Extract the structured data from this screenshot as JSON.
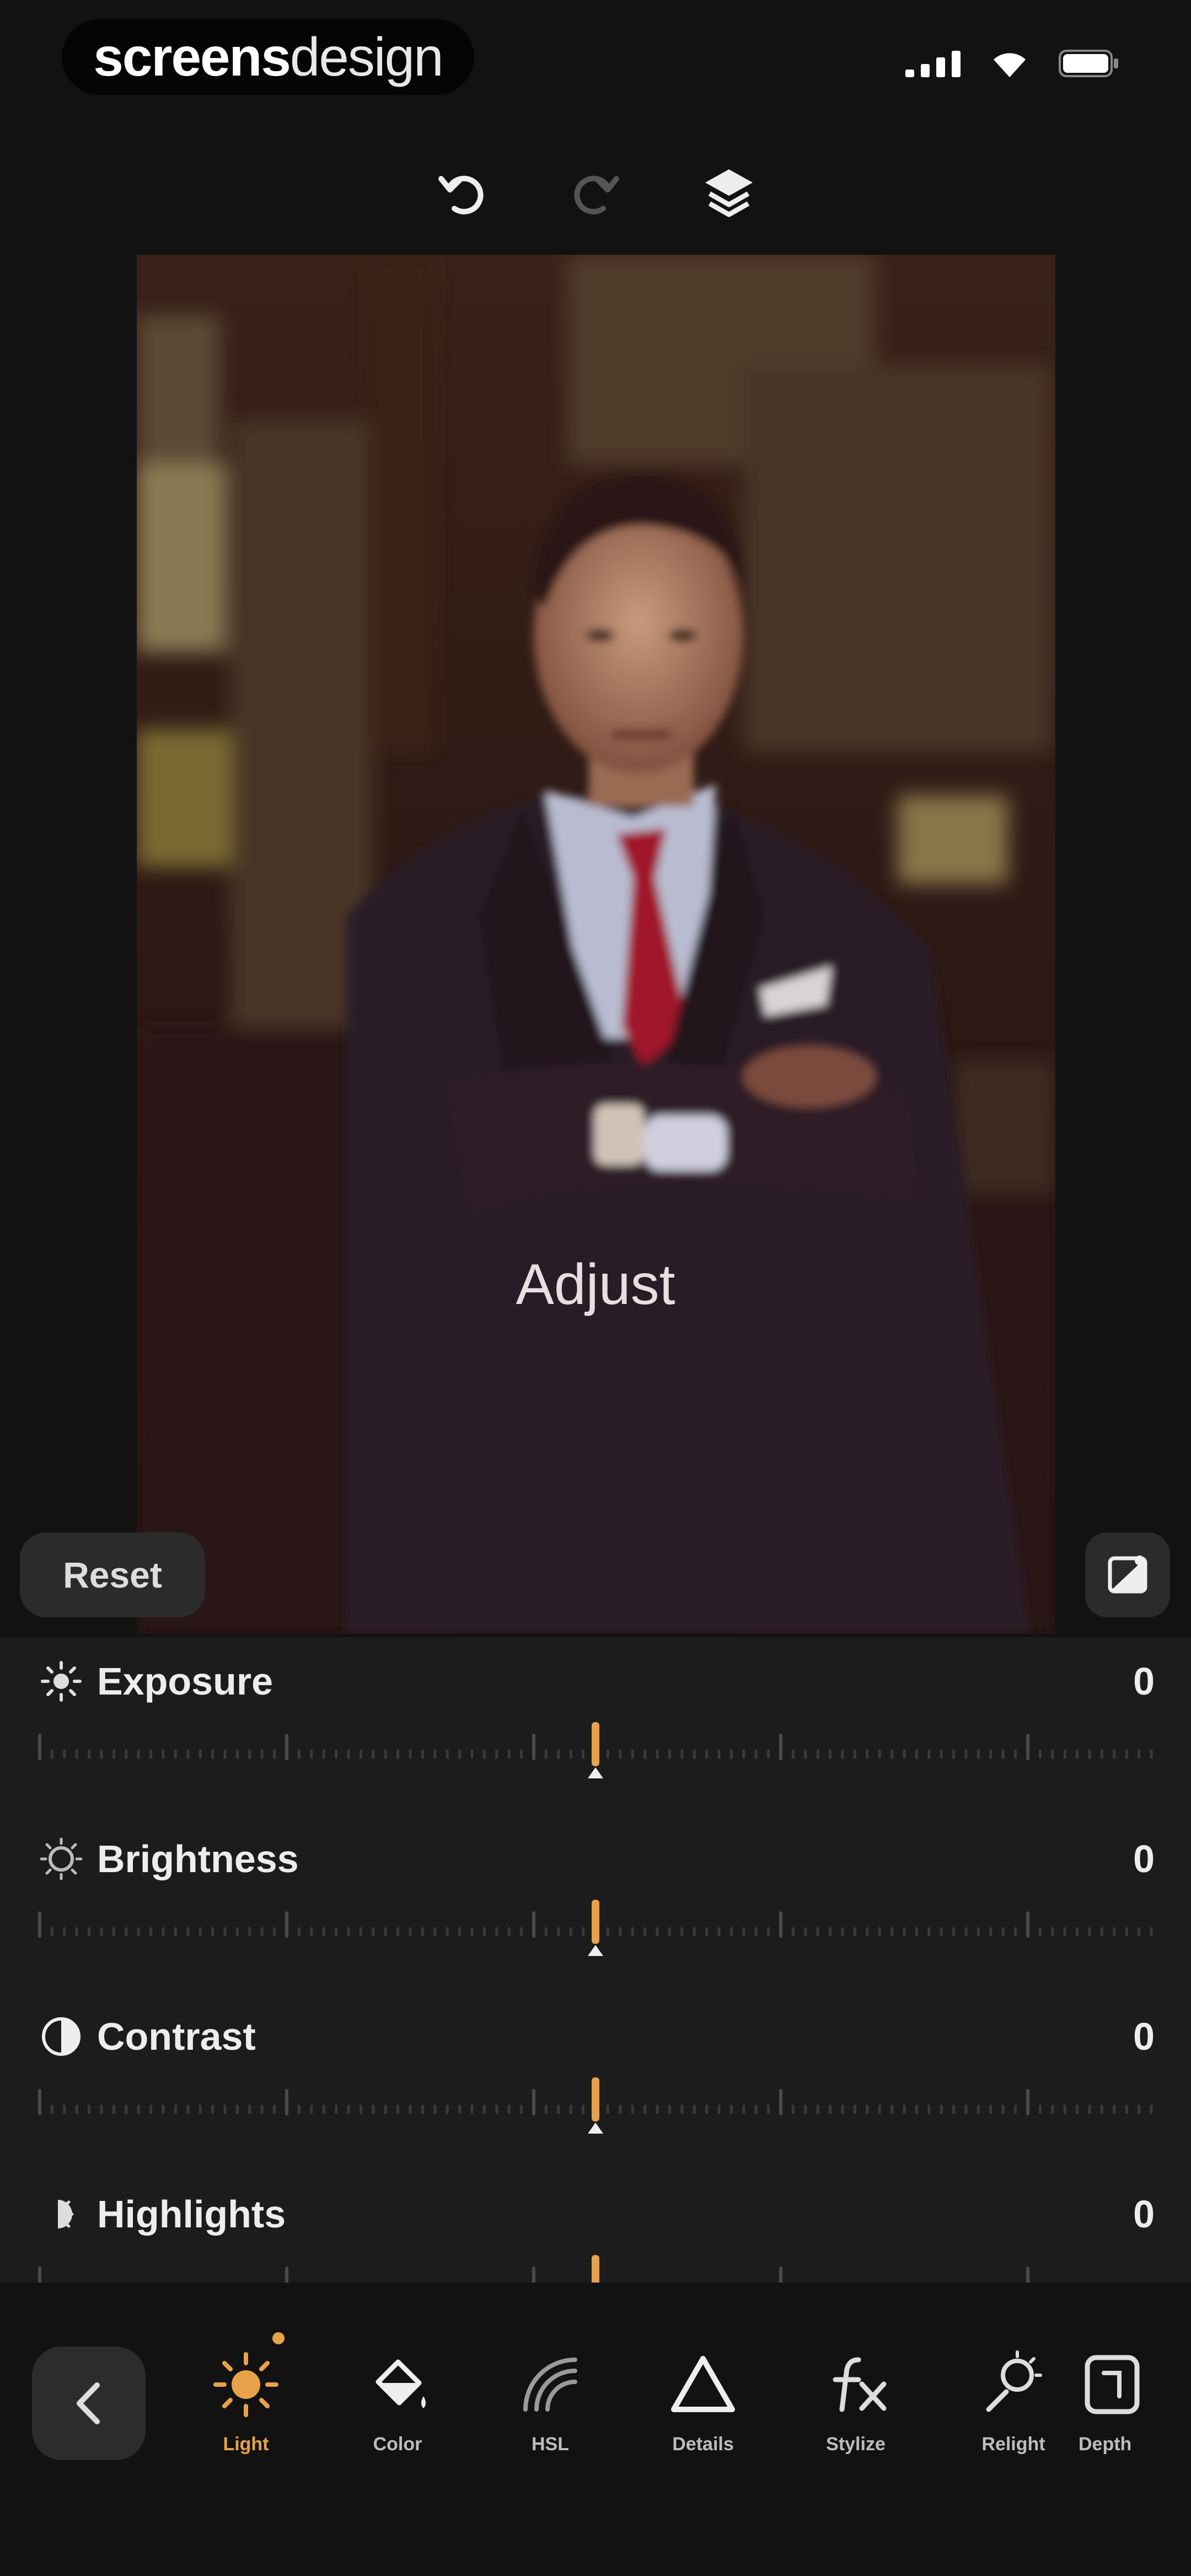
{
  "status_bar": {
    "brand_bold": "screens",
    "brand_light": "design"
  },
  "toolbar": {
    "undo_icon": "undo-icon",
    "redo_icon": "redo-icon",
    "layers_icon": "layers-icon"
  },
  "editor": {
    "mode_label": "Adjust",
    "reset_label": "Reset",
    "compare_icon": "compare-icon"
  },
  "adjustments": [
    {
      "label": "Exposure",
      "value": "0",
      "icon": "exposure-icon",
      "level": 0.5
    },
    {
      "label": "Brightness",
      "value": "0",
      "icon": "brightness-icon",
      "level": 0.5
    },
    {
      "label": "Contrast",
      "value": "0",
      "icon": "contrast-icon",
      "level": 0.5
    },
    {
      "label": "Highlights",
      "value": "0",
      "icon": "highlights-icon",
      "level": 0.5
    }
  ],
  "tabs": [
    {
      "label": "Light",
      "icon": "sun-icon",
      "active": true
    },
    {
      "label": "Color",
      "icon": "paint-bucket-icon",
      "active": false
    },
    {
      "label": "HSL",
      "icon": "rainbow-icon",
      "active": false
    },
    {
      "label": "Details",
      "icon": "triangle-icon",
      "active": false
    },
    {
      "label": "Stylize",
      "icon": "fx-icon",
      "active": false
    },
    {
      "label": "Relight",
      "icon": "relight-icon",
      "active": false
    },
    {
      "label": "Depth",
      "icon": "depth-icon",
      "active": false
    }
  ],
  "colors": {
    "accent": "#e8a24a",
    "background": "#121212",
    "panel": "#1c1c1c"
  }
}
